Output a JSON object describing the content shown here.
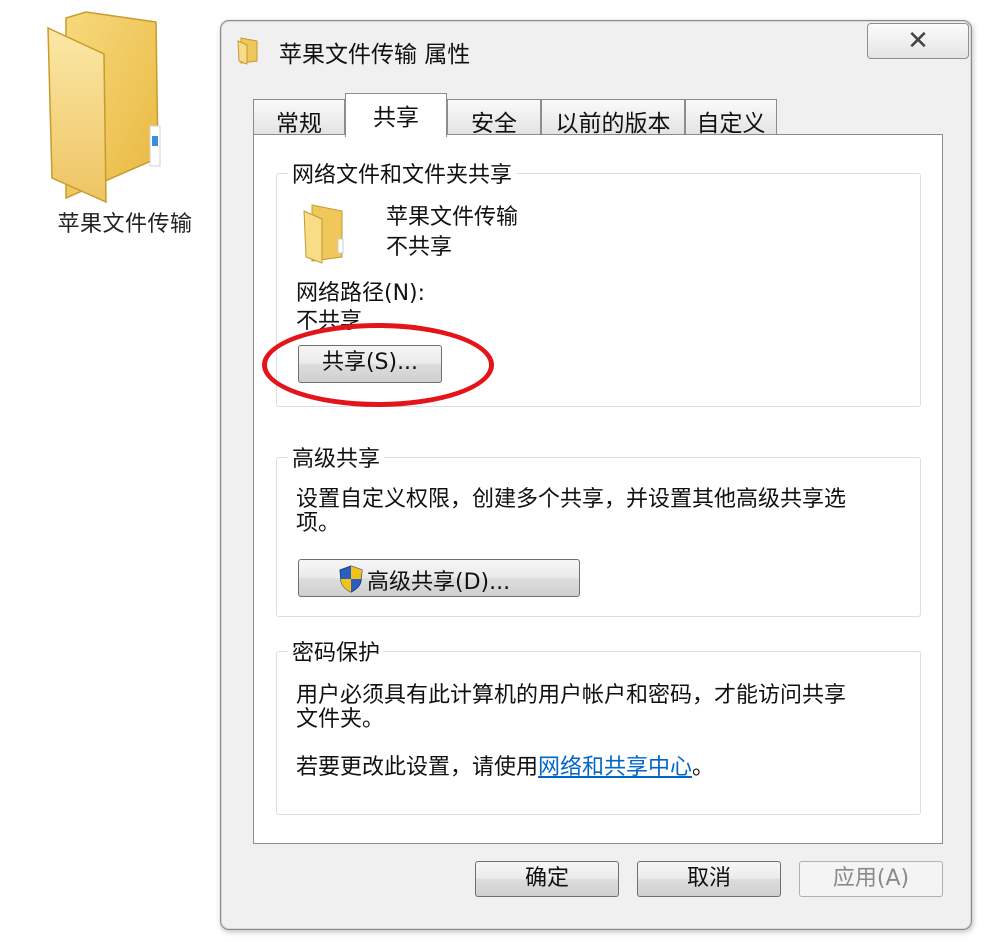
{
  "desktop": {
    "folder_label": "苹果文件传输",
    "folder_icon": "folder-icon"
  },
  "dialog": {
    "title": "苹果文件传输 属性",
    "close_glyph": "✕",
    "tabs": [
      {
        "label": "常规",
        "active": false
      },
      {
        "label": "共享",
        "active": true
      },
      {
        "label": "安全",
        "active": false
      },
      {
        "label": "以前的版本",
        "active": false
      },
      {
        "label": "自定义",
        "active": false
      }
    ],
    "network_sharing": {
      "group_title": "网络文件和文件夹共享",
      "folder_name": "苹果文件传输",
      "status": "不共享",
      "path_label": "网络路径(N):",
      "path_value": "不共享",
      "share_button": "共享(S)..."
    },
    "advanced_sharing": {
      "group_title": "高级共享",
      "description_line1": "设置自定义权限，创建多个共享，并设置其他高级共享选",
      "description_line2": "项。",
      "button": "高级共享(D)..."
    },
    "password_protection": {
      "group_title": "密码保护",
      "description_line1": "用户必须具有此计算机的用户帐户和密码，才能访问共享",
      "description_line2": "文件夹。",
      "change_prefix": "若要更改此设置，请使用",
      "change_link": "网络和共享中心",
      "change_suffix": "。"
    },
    "footer": {
      "ok": "确定",
      "cancel": "取消",
      "apply": "应用(A)"
    }
  },
  "colors": {
    "highlight_ring": "#e3151a",
    "link": "#0066cc"
  }
}
